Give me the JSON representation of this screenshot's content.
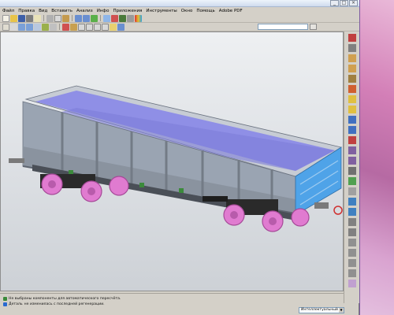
{
  "menu": {
    "items": [
      "Файл",
      "Правка",
      "Вид",
      "Вставить",
      "Анализ",
      "Инфо",
      "Приложения",
      "Инструменты",
      "Окно",
      "Помощь",
      "Adobe PDF"
    ]
  },
  "window": {
    "controls": {
      "minimize": "_",
      "maximize": "□",
      "close": "×"
    }
  },
  "status": {
    "line1": "Не выбраны компоненты для автоматического пересчёта.",
    "line2_label": "Деталь",
    "line2_text": "не изменилась с последней регенерации.",
    "mode_value": "Интеллектуальный"
  },
  "colors": {
    "car_body": "#9aa4b2",
    "car_inner": "#8f8fe6",
    "end_wall": "#4fa3e8",
    "wheels": "#e07bd0",
    "bogie": "#2a2a2a",
    "desktop": "#c87ab4"
  },
  "icons": {
    "toolbar1": [
      "new-file-icon",
      "open-folder-icon",
      "save-icon",
      "print-icon",
      "email-icon",
      "cut-icon",
      "copy-icon",
      "paste-icon",
      "undo-icon",
      "redo-icon",
      "regenerate-icon",
      "window-icon",
      "close-window-icon",
      "model-tree-icon",
      "layers-icon",
      "colors-icon"
    ],
    "toolbar2": [
      "orient-icon",
      "repaint-icon",
      "zoom-in-icon",
      "zoom-out-icon",
      "refit-icon",
      "reorient-icon",
      "saved-views-icon",
      "spin-center-icon",
      "display-style-icon",
      "plane-display-icon",
      "axis-display-icon",
      "point-display-icon",
      "csys-display-icon",
      "annotation-icon",
      "help-icon"
    ],
    "right_tools": [
      "sketch-icon",
      "line-icon",
      "datum-plane-icon",
      "datum-axis-icon",
      "datum-point-icon",
      "csys-icon",
      "extrude-icon",
      "revolve-icon",
      "sweep-icon",
      "blend-icon",
      "hole-icon",
      "round-icon",
      "chamfer-icon",
      "rib-icon",
      "draft-icon",
      "shell-icon",
      "pattern-icon",
      "mirror-icon",
      "merge-icon",
      "trim-icon",
      "offset-icon",
      "thicken-icon",
      "solidify-icon",
      "wrap-icon",
      "style-icon"
    ]
  }
}
